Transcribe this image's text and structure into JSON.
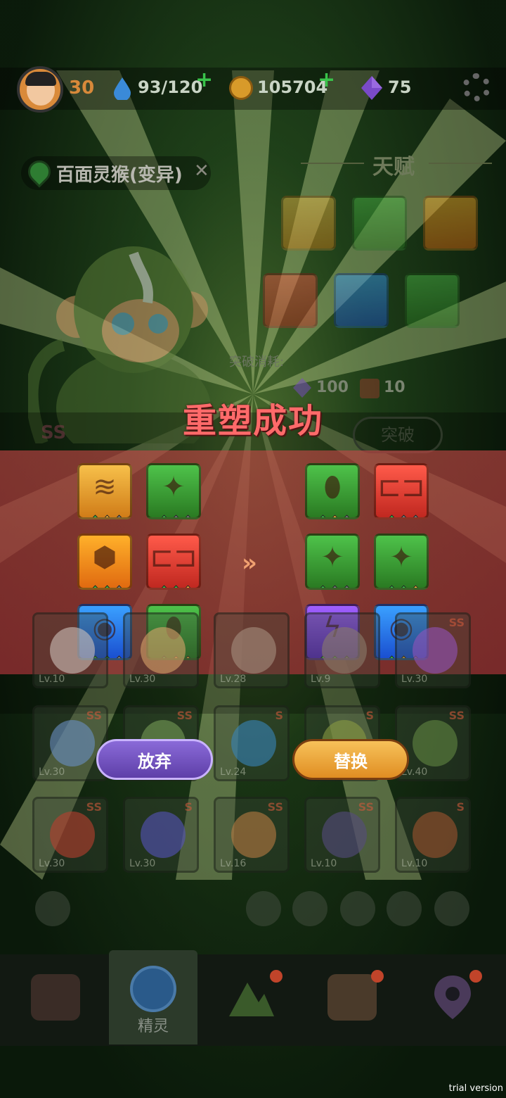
{
  "header": {
    "level": "30",
    "energy": "93/120",
    "coins": "105704",
    "gems": "75"
  },
  "pet": {
    "name": "百面灵猴(变异)",
    "rank": "SS"
  },
  "talent": {
    "title": "天赋"
  },
  "breakthrough": {
    "cost_label": "突破消耗:",
    "cost_gems": "100",
    "cost_items": "10",
    "button": "突破"
  },
  "popup": {
    "title": "重塑成功",
    "arrow": "»",
    "before": [
      {
        "icon": "gold-shield-icon",
        "color": "gold",
        "sym": "≋",
        "dots": [
          "green",
          "gold",
          "gray"
        ]
      },
      {
        "icon": "green-spike-icon",
        "color": "green",
        "sym": "✦",
        "dots": [
          "green",
          "gray",
          "gray"
        ]
      },
      {
        "icon": "crystal-icon",
        "color": "orange",
        "sym": "⬢",
        "dots": [
          "green",
          "green",
          "gray"
        ]
      },
      {
        "icon": "fang-icon",
        "color": "red",
        "sym": "⊏⊐",
        "dots": [
          "green",
          "green",
          "gold"
        ]
      },
      {
        "icon": "eye-icon",
        "color": "blue",
        "sym": "◉",
        "dots": [
          "green",
          "green",
          "gray"
        ]
      },
      {
        "icon": "green-drop-icon",
        "color": "green",
        "sym": "⬮",
        "dots": [
          "green",
          "gold",
          "gold"
        ]
      }
    ],
    "after": [
      {
        "icon": "green-drop-icon",
        "color": "green",
        "sym": "⬮",
        "dots": [
          "green",
          "gold",
          "gray"
        ]
      },
      {
        "icon": "fang-icon",
        "color": "red",
        "sym": "⊏⊐",
        "dots": [
          "green",
          "gray",
          "gray"
        ]
      },
      {
        "icon": "green-spike-icon",
        "color": "green",
        "sym": "✦",
        "dots": [
          "green",
          "gray",
          "gray"
        ]
      },
      {
        "icon": "green-spike-icon",
        "color": "green",
        "sym": "✦",
        "dots": [
          "green",
          "green",
          "gold"
        ]
      },
      {
        "icon": "lightning-icon",
        "color": "purple",
        "sym": "ϟ",
        "dots": [
          "green",
          "green",
          "gray"
        ]
      },
      {
        "icon": "eye-icon",
        "color": "blue",
        "sym": "◉",
        "dots": [
          "green",
          "gold",
          "gray"
        ]
      }
    ],
    "abandon_label": "放弃",
    "replace_label": "替换"
  },
  "pets": [
    {
      "lv": "Lv.10",
      "rank": "",
      "color": "#b0a8a0"
    },
    {
      "lv": "Lv.30",
      "rank": "",
      "color": "#b89060"
    },
    {
      "lv": "Lv.28",
      "rank": "",
      "color": "#908070"
    },
    {
      "lv": "Lv.9",
      "rank": "",
      "color": "#7a7060"
    },
    {
      "lv": "Lv.30",
      "rank": "SS",
      "color": "#8050a0"
    },
    {
      "lv": "Lv.30",
      "rank": "SS",
      "color": "#6080a8"
    },
    {
      "lv": "",
      "rank": "SS",
      "color": "#6a8a50"
    },
    {
      "lv": "Lv.24",
      "rank": "S",
      "color": "#3878a0"
    },
    {
      "lv": "",
      "rank": "S",
      "color": "#7a8a40"
    },
    {
      "lv": "Lv.40",
      "rank": "SS",
      "color": "#5a7a40"
    },
    {
      "lv": "Lv.30",
      "rank": "SS",
      "color": "#a04030"
    },
    {
      "lv": "Lv.30",
      "rank": "S",
      "color": "#5050a0"
    },
    {
      "lv": "Lv.16",
      "rank": "SS",
      "color": "#a07040"
    },
    {
      "lv": "Lv.10",
      "rank": "SS",
      "color": "#504a70"
    },
    {
      "lv": "Lv.10",
      "rank": "S",
      "color": "#8a5030"
    }
  ],
  "nav": {
    "selected_label": "精灵"
  },
  "watermark": "trial version"
}
